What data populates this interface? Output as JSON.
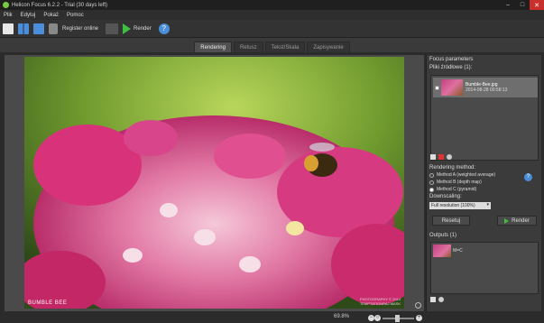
{
  "window": {
    "title": "Helicon Focus 6.2.2 - Trial (30 days left)"
  },
  "menu": [
    "Plik",
    "Edytuj",
    "Pokaż",
    "Pomoc"
  ],
  "toolbar": {
    "register_label": "Register online",
    "render_label": "Render"
  },
  "tabs": [
    "Rendering",
    "Retusz",
    "Tekst/Skala",
    "Zapisywanie"
  ],
  "viewer": {
    "caption_left": "BUMBLE BEE",
    "caption_right_line1": "PHOTOGRAPHY © 2014",
    "caption_right_line2": "TEMPTATIONRAJ MASK"
  },
  "status": {
    "zoom": "69.8%"
  },
  "panel": {
    "title": "Focus parameters",
    "source_label": "Pliki źródłowe (1):",
    "file": {
      "name": "Bumble-Bee.jpg",
      "date": "2014-08-28 00:58:13"
    },
    "method_label": "Rendering method:",
    "methods": [
      "Method A (weighted average)",
      "Method B (depth map)",
      "Method C (pyramid)"
    ],
    "selected_method": 2,
    "downscaling_label": "Downscaling:",
    "downscaling_value": "Full resolution (100%)",
    "reset_label": "Resetuj",
    "render_label": "Render",
    "outputs_label": "Outputs (1)",
    "output_name": "M=C"
  },
  "colors": {
    "accent": "#4a8ed9",
    "render_green": "#3fbf3f",
    "close_red": "#c9302c"
  }
}
